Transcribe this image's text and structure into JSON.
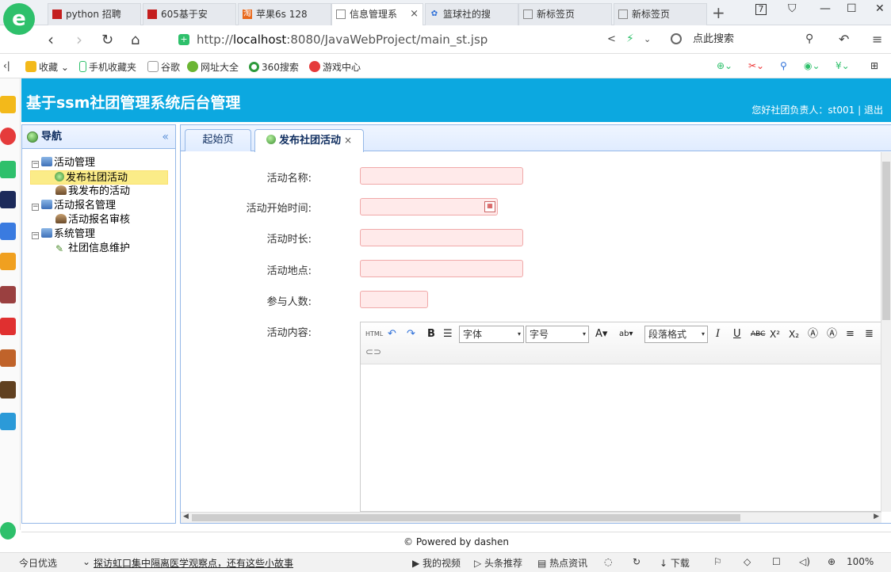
{
  "browser": {
    "tabs": [
      {
        "label": "python 招聘",
        "active": false
      },
      {
        "label": "605基于安",
        "active": false
      },
      {
        "label": "苹果6s 128",
        "active": false
      },
      {
        "label": "信息管理系",
        "active": true
      },
      {
        "label": "篮球社的搜",
        "active": false
      },
      {
        "label": "新标签页",
        "active": false
      },
      {
        "label": "新标签页",
        "active": false
      }
    ],
    "url_prefix": "http://",
    "url_host": "localhost",
    "url_rest": ":8080/JavaWebProject/main_st.jsp",
    "search_placeholder": "点此搜索",
    "bookmarks": [
      "收藏",
      "手机收藏夹",
      "谷歌",
      "网址大全",
      "360搜索",
      "游戏中心"
    ]
  },
  "app": {
    "title": "基于ssm社团管理系统后台管理",
    "user_greeting": "您好社团负责人：st001",
    "separator": "|",
    "logout": "退出",
    "accent_color": "#0ca8e0"
  },
  "nav": {
    "title": "导航",
    "collapse_glyph": "«",
    "tree": [
      {
        "label": "活动管理",
        "level": 0,
        "expanded": true
      },
      {
        "label": "发布社团活动",
        "level": 1,
        "selected": true
      },
      {
        "label": "我发布的活动",
        "level": 1
      },
      {
        "label": "活动报名管理",
        "level": 0,
        "expanded": true
      },
      {
        "label": "活动报名审核",
        "level": 1
      },
      {
        "label": "系统管理",
        "level": 0,
        "expanded": true
      },
      {
        "label": "社团信息维护",
        "level": 1
      }
    ]
  },
  "content_tabs": [
    {
      "label": "起始页",
      "active": false
    },
    {
      "label": "发布社团活动",
      "active": true,
      "close": "×"
    }
  ],
  "form": {
    "fields": [
      {
        "label": "活动名称:",
        "value": ""
      },
      {
        "label": "活动开始时间:",
        "value": ""
      },
      {
        "label": "活动时长:",
        "value": ""
      },
      {
        "label": "活动地点:",
        "value": ""
      },
      {
        "label": "参与人数:",
        "value": ""
      },
      {
        "label": "活动内容:"
      }
    ],
    "editor": {
      "html_btn": "HTML",
      "bold": "B",
      "font_family": "字体",
      "font_size": "字号",
      "paragraph": "段落格式",
      "italic": "I",
      "underline": "U",
      "strike": "ABC",
      "sup": "X²",
      "sub": "X₂"
    }
  },
  "footer": {
    "text": "© Powered by dashen"
  },
  "statusbar": {
    "items": [
      "今日优选",
      "探访虹口集中隔离医学观察点，还有这些小故事",
      "我的视频",
      "头条推荐",
      "热点资讯",
      "下载",
      "100%"
    ]
  },
  "window_controls": {
    "restore": "7",
    "minimize": "—",
    "maximize": "☐",
    "close": "✕"
  }
}
